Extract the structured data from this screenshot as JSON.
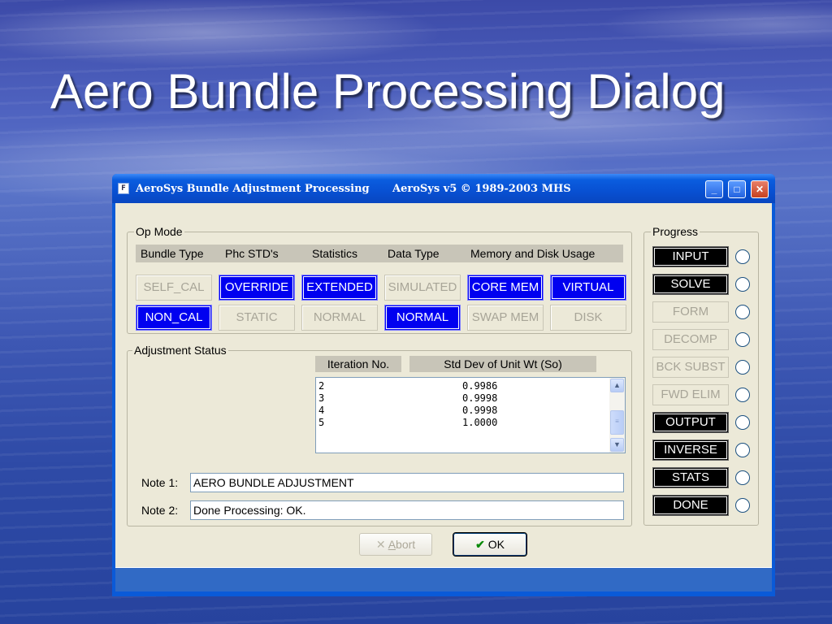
{
  "slide": {
    "title": "Aero Bundle Processing Dialog"
  },
  "window": {
    "title": "AeroSys Bundle Adjustment Processing",
    "version_text": "AeroSys v5 © 1989-2003 MHS",
    "controls": {
      "minimize": "_",
      "maximize": "□",
      "close": "✕"
    }
  },
  "op_mode": {
    "label": "Op Mode",
    "headers": [
      "Bundle Type",
      "Phc STD's",
      "Statistics",
      "Data Type",
      "Memory and Disk Usage"
    ],
    "row1": [
      {
        "label": "SELF_CAL",
        "active": false
      },
      {
        "label": "OVERRIDE",
        "active": true
      },
      {
        "label": "EXTENDED",
        "active": true
      },
      {
        "label": "SIMULATED",
        "active": false
      },
      {
        "label": "CORE MEM",
        "active": true
      },
      {
        "label": "VIRTUAL",
        "active": true
      }
    ],
    "row2": [
      {
        "label": "NON_CAL",
        "active": true
      },
      {
        "label": "STATIC",
        "active": false
      },
      {
        "label": "NORMAL",
        "active": false
      },
      {
        "label": "NORMAL",
        "active": true
      },
      {
        "label": "SWAP MEM",
        "active": false
      },
      {
        "label": "DISK",
        "active": false
      }
    ]
  },
  "adjustment_status": {
    "label": "Adjustment  Status",
    "columns": [
      "Iteration No.",
      "Std Dev of Unit Wt (So)"
    ],
    "rows": [
      {
        "iteration": "2",
        "std_dev": "0.9986"
      },
      {
        "iteration": "3",
        "std_dev": "0.9998"
      },
      {
        "iteration": "4",
        "std_dev": "0.9998"
      },
      {
        "iteration": "5",
        "std_dev": "1.0000"
      }
    ],
    "note1": {
      "label": "Note 1:",
      "value": "AERO  BUNDLE  ADJUSTMENT"
    },
    "note2": {
      "label": "Note 2:",
      "value": "Done Processing: OK."
    }
  },
  "progress": {
    "label": "Progress",
    "steps": [
      {
        "label": "INPUT",
        "done": true
      },
      {
        "label": "SOLVE",
        "done": true
      },
      {
        "label": "FORM",
        "done": false
      },
      {
        "label": "DECOMP",
        "done": false
      },
      {
        "label": "BCK SUBST",
        "done": false
      },
      {
        "label": "FWD ELIM",
        "done": false
      },
      {
        "label": "OUTPUT",
        "done": true
      },
      {
        "label": "INVERSE",
        "done": true
      },
      {
        "label": "STATS",
        "done": true
      },
      {
        "label": "DONE",
        "done": true
      }
    ]
  },
  "buttons": {
    "abort": "Abort",
    "abort_mnemonic": "A",
    "abort_rest": "bort",
    "ok": "OK"
  },
  "icons": {
    "abort": "x-icon",
    "ok": "checkmark-icon",
    "app": "app-icon"
  },
  "colors": {
    "active_mode": "#0000f0",
    "active_progress": "#000000",
    "titlebar": "#0a5ad8",
    "dialog_bg": "#ece9d8"
  }
}
